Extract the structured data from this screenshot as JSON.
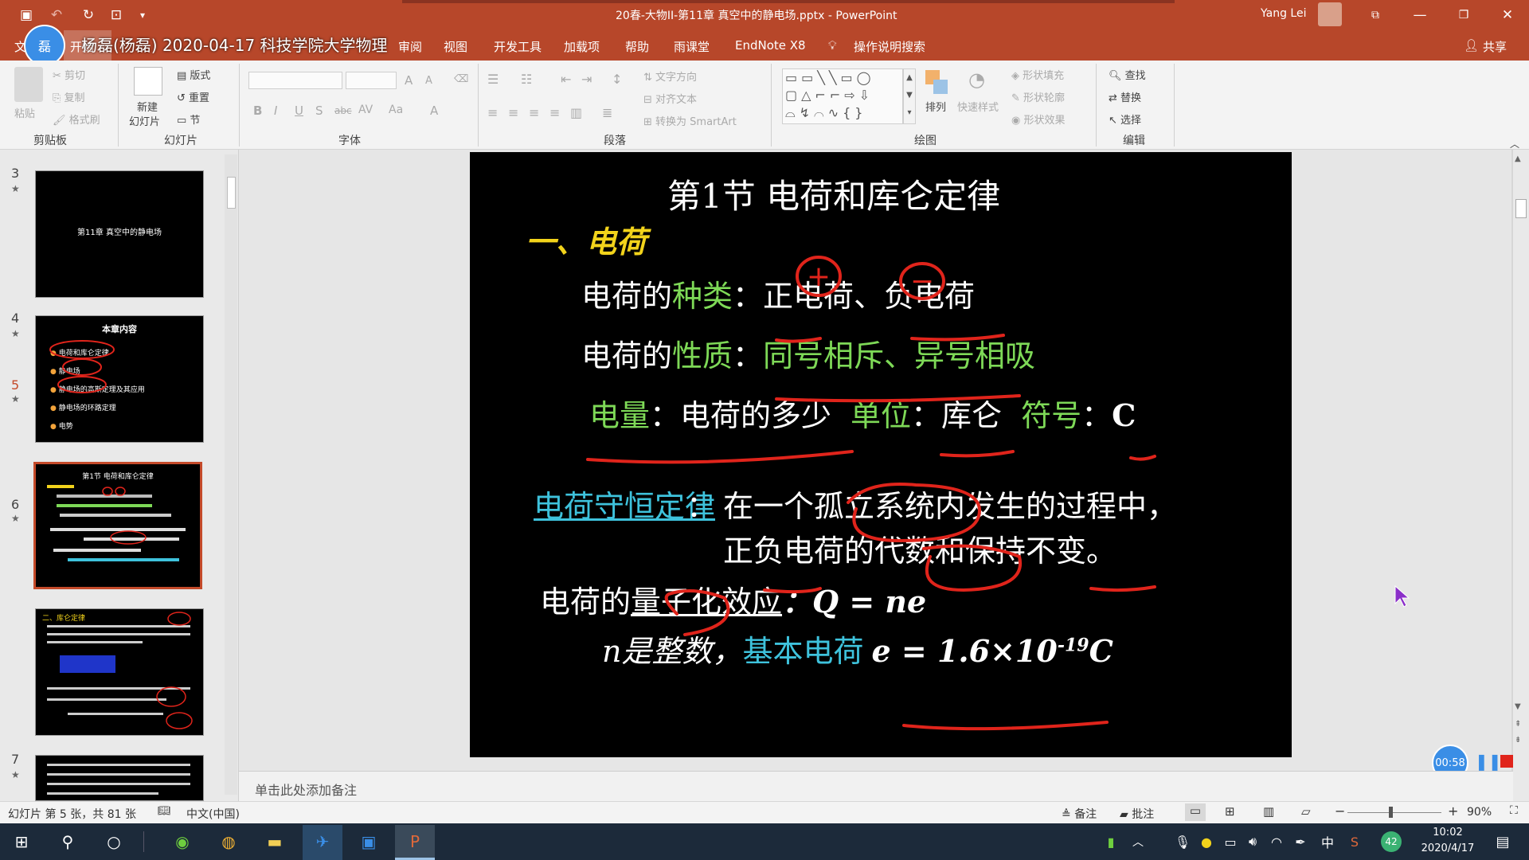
{
  "window": {
    "title": "20春-大物II-第11章 真空中的静电场.pptx  -  PowerPoint",
    "user": "Yang Lei",
    "meeting_label": "杨磊(杨磊) 2020-04-17 科技学院大学物理",
    "avatar_badge": "磊"
  },
  "tabs": {
    "file": "文",
    "home": "开始",
    "review": "审阅",
    "view": "视图",
    "developer": "开发工具",
    "addins": "加载项",
    "help": "帮助",
    "rainclass": "雨课堂",
    "endnote": "EndNote X8",
    "tellme": "操作说明搜索",
    "share": "共享"
  },
  "ribbon": {
    "clipboard": {
      "paste": "粘贴",
      "cut": "剪切",
      "copy": "复制",
      "format_painter": "格式刷",
      "label": "剪贴板"
    },
    "slides": {
      "new_slide_1": "新建",
      "new_slide_2": "幻灯片",
      "layout": "版式",
      "reset": "重置",
      "section": "节",
      "label": "幻灯片"
    },
    "font": {
      "label": "字体"
    },
    "paragraph": {
      "text_direction": "文字方向",
      "align_text": "对齐文本",
      "smartart": "转换为 SmartArt",
      "label": "段落"
    },
    "drawing": {
      "arrange": "排列",
      "quick_styles": "快速样式",
      "shape_fill": "形状填充",
      "shape_outline": "形状轮廓",
      "shape_effects": "形状效果",
      "label": "绘图"
    },
    "editing": {
      "find": "查找",
      "replace": "替换",
      "select": "选择",
      "label": "编辑"
    }
  },
  "thumbnails": [
    {
      "num": "3",
      "title": "第11章 真空中的静电场"
    },
    {
      "num": "4",
      "title": "本章内容",
      "items": [
        "电荷和库仑定律",
        "静电场",
        "静电场的高斯定理及其应用",
        "静电场的环路定理",
        "电势"
      ]
    },
    {
      "num": "5",
      "title": "第1节  电荷和库仑定律"
    },
    {
      "num": "6",
      "title": "二、库仑定律"
    },
    {
      "num": "7",
      "title": ""
    }
  ],
  "slide": {
    "title": "第1节    电荷和库仑定律",
    "section": "一、电荷",
    "kinds_prefix": "电荷的",
    "kinds_key": "种类",
    "kinds_colon": "：",
    "kinds_value": "正电荷、负电荷",
    "plus_mark": "+",
    "minus_mark": "−",
    "nature_prefix": "电荷的",
    "nature_key": "性质",
    "nature_colon": "：",
    "nature_value": "同号相斥、异号相吸",
    "qty_key": "电量",
    "qty_value": "：电荷的多少",
    "unit_key": "单位",
    "unit_value": "：库仑",
    "symbol_key": "符号",
    "symbol_colon": "：",
    "symbol_value": "C",
    "law_title": "电荷守恒定律",
    "law_colon": "：",
    "law_line1": "在一个孤立系统内发生的过程中，",
    "law_line2": "正负电荷的代数和保持不变。",
    "quant_prefix": "电荷的",
    "quant_key": "量子化效应",
    "quant_formula": "：Q = ne",
    "n_text": "n是整数，",
    "base_charge": "基本电荷",
    "e_formula": "e = 1.6×10",
    "e_exp": "-19",
    "e_unit": "C"
  },
  "notes_placeholder": "单击此处添加备注",
  "status": {
    "slide_info": "幻灯片 第 5 张，共 81 张",
    "language": "中文(中国)",
    "notes": "备注",
    "comments": "批注",
    "zoom": "90%"
  },
  "recorder": {
    "time": "00:58"
  },
  "taskbar": {
    "ime": "中",
    "badge": "42",
    "time": "10:02",
    "date": "2020/4/17"
  },
  "colors": {
    "accent": "#b7472a",
    "slide_yellow": "#f2d31b",
    "slide_green": "#7ed957",
    "slide_cyan": "#3ec2dc",
    "annotation_red": "#e0241b"
  }
}
